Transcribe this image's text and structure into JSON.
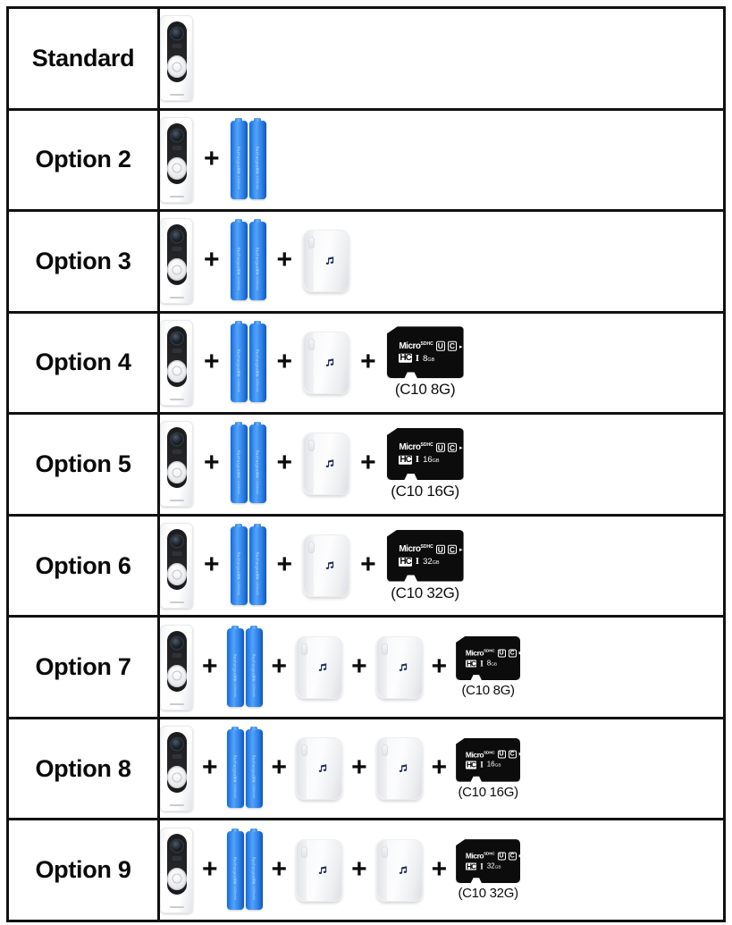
{
  "table": {
    "rows": [
      {
        "label": "Standard",
        "items": [
          {
            "type": "doorbell",
            "name": "video-doorbell"
          }
        ]
      },
      {
        "label": "Option 2",
        "items": [
          {
            "type": "doorbell",
            "name": "video-doorbell"
          },
          {
            "type": "batteries",
            "name": "rechargeable-batteries"
          }
        ]
      },
      {
        "label": "Option 3",
        "items": [
          {
            "type": "doorbell",
            "name": "video-doorbell"
          },
          {
            "type": "batteries",
            "name": "rechargeable-batteries"
          },
          {
            "type": "chime",
            "name": "wireless-chime"
          }
        ]
      },
      {
        "label": "Option 4",
        "items": [
          {
            "type": "doorbell",
            "name": "video-doorbell"
          },
          {
            "type": "batteries",
            "name": "rechargeable-batteries"
          },
          {
            "type": "chime",
            "name": "wireless-chime"
          },
          {
            "type": "sdcard",
            "name": "microsd-card",
            "capacity": "8",
            "capacity_unit": "GB",
            "caption": "(C10 8G)"
          }
        ]
      },
      {
        "label": "Option 5",
        "items": [
          {
            "type": "doorbell",
            "name": "video-doorbell"
          },
          {
            "type": "batteries",
            "name": "rechargeable-batteries"
          },
          {
            "type": "chime",
            "name": "wireless-chime"
          },
          {
            "type": "sdcard",
            "name": "microsd-card",
            "capacity": "16",
            "capacity_unit": "GB",
            "caption": "(C10 16G)"
          }
        ]
      },
      {
        "label": "Option 6",
        "items": [
          {
            "type": "doorbell",
            "name": "video-doorbell"
          },
          {
            "type": "batteries",
            "name": "rechargeable-batteries"
          },
          {
            "type": "chime",
            "name": "wireless-chime"
          },
          {
            "type": "sdcard",
            "name": "microsd-card",
            "capacity": "32",
            "capacity_unit": "GB",
            "caption": "(C10 32G)"
          }
        ]
      },
      {
        "label": "Option 7",
        "items": [
          {
            "type": "doorbell",
            "name": "video-doorbell"
          },
          {
            "type": "batteries",
            "name": "rechargeable-batteries"
          },
          {
            "type": "chime",
            "name": "wireless-chime"
          },
          {
            "type": "chime",
            "name": "wireless-chime-second"
          },
          {
            "type": "sdcard",
            "name": "microsd-card",
            "size": "small",
            "capacity": "8",
            "capacity_unit": "GB",
            "caption": "(C10 8G)"
          }
        ]
      },
      {
        "label": "Option 8",
        "items": [
          {
            "type": "doorbell",
            "name": "video-doorbell"
          },
          {
            "type": "batteries",
            "name": "rechargeable-batteries"
          },
          {
            "type": "chime",
            "name": "wireless-chime"
          },
          {
            "type": "chime",
            "name": "wireless-chime-second"
          },
          {
            "type": "sdcard",
            "name": "microsd-card",
            "size": "small",
            "capacity": "16",
            "capacity_unit": "GB",
            "caption": "(C10 16G)"
          }
        ]
      },
      {
        "label": "Option 9",
        "items": [
          {
            "type": "doorbell",
            "name": "video-doorbell"
          },
          {
            "type": "batteries",
            "name": "rechargeable-batteries"
          },
          {
            "type": "chime",
            "name": "wireless-chime"
          },
          {
            "type": "chime",
            "name": "wireless-chime-second"
          },
          {
            "type": "sdcard",
            "name": "microsd-card",
            "size": "small",
            "capacity": "32",
            "capacity_unit": "GB",
            "caption": "(C10 32G)"
          }
        ]
      }
    ],
    "separator_symbol": "+",
    "sd_brand_text": "Micro",
    "sd_brand_sup": "SDHC",
    "sd_speed_u": "U",
    "sd_speed_c": "C",
    "sd_bus": "I",
    "sd_hc_badge": "HC",
    "battery_text_top": "Rechargeable",
    "battery_text_bottom": "1.5V 1200mAh"
  },
  "colors": {
    "border": "#111111",
    "battery_blue": "#2f86ef",
    "sd_black": "#0c0c0c",
    "text": "#0a0a0a",
    "chime_white": "#f7f8f9",
    "note_blue": "#1f2b55"
  }
}
